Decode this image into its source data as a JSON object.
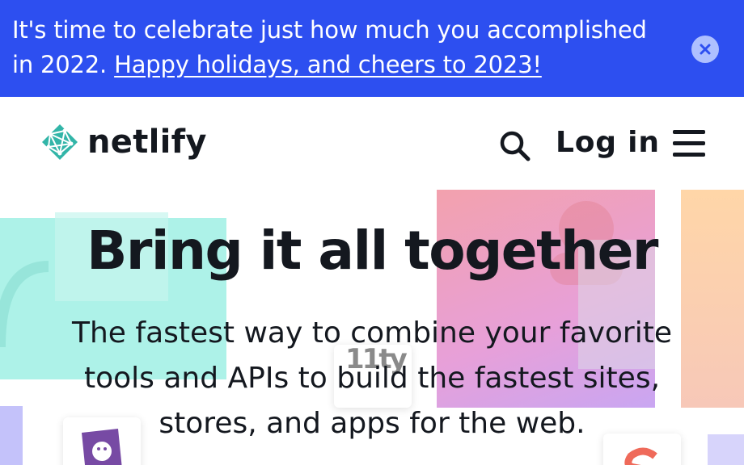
{
  "banner": {
    "text": "It's time to celebrate just how much you accomplished in 2022.",
    "link": "Happy holidays, and cheers to 2023!",
    "close_icon": "close-icon",
    "background": "#2d4ff0"
  },
  "header": {
    "brand": "netlify",
    "logo_icon": "netlify-logo-icon",
    "search_icon": "search-icon",
    "login_label": "Log in",
    "menu_icon": "hamburger-menu-icon"
  },
  "hero": {
    "title": "Bring it all together",
    "subtitle": "The fastest way to combine your favorite tools and APIs to build the fastest sites, stores, and apps for the web.",
    "eleventy_logo": "11ty"
  }
}
